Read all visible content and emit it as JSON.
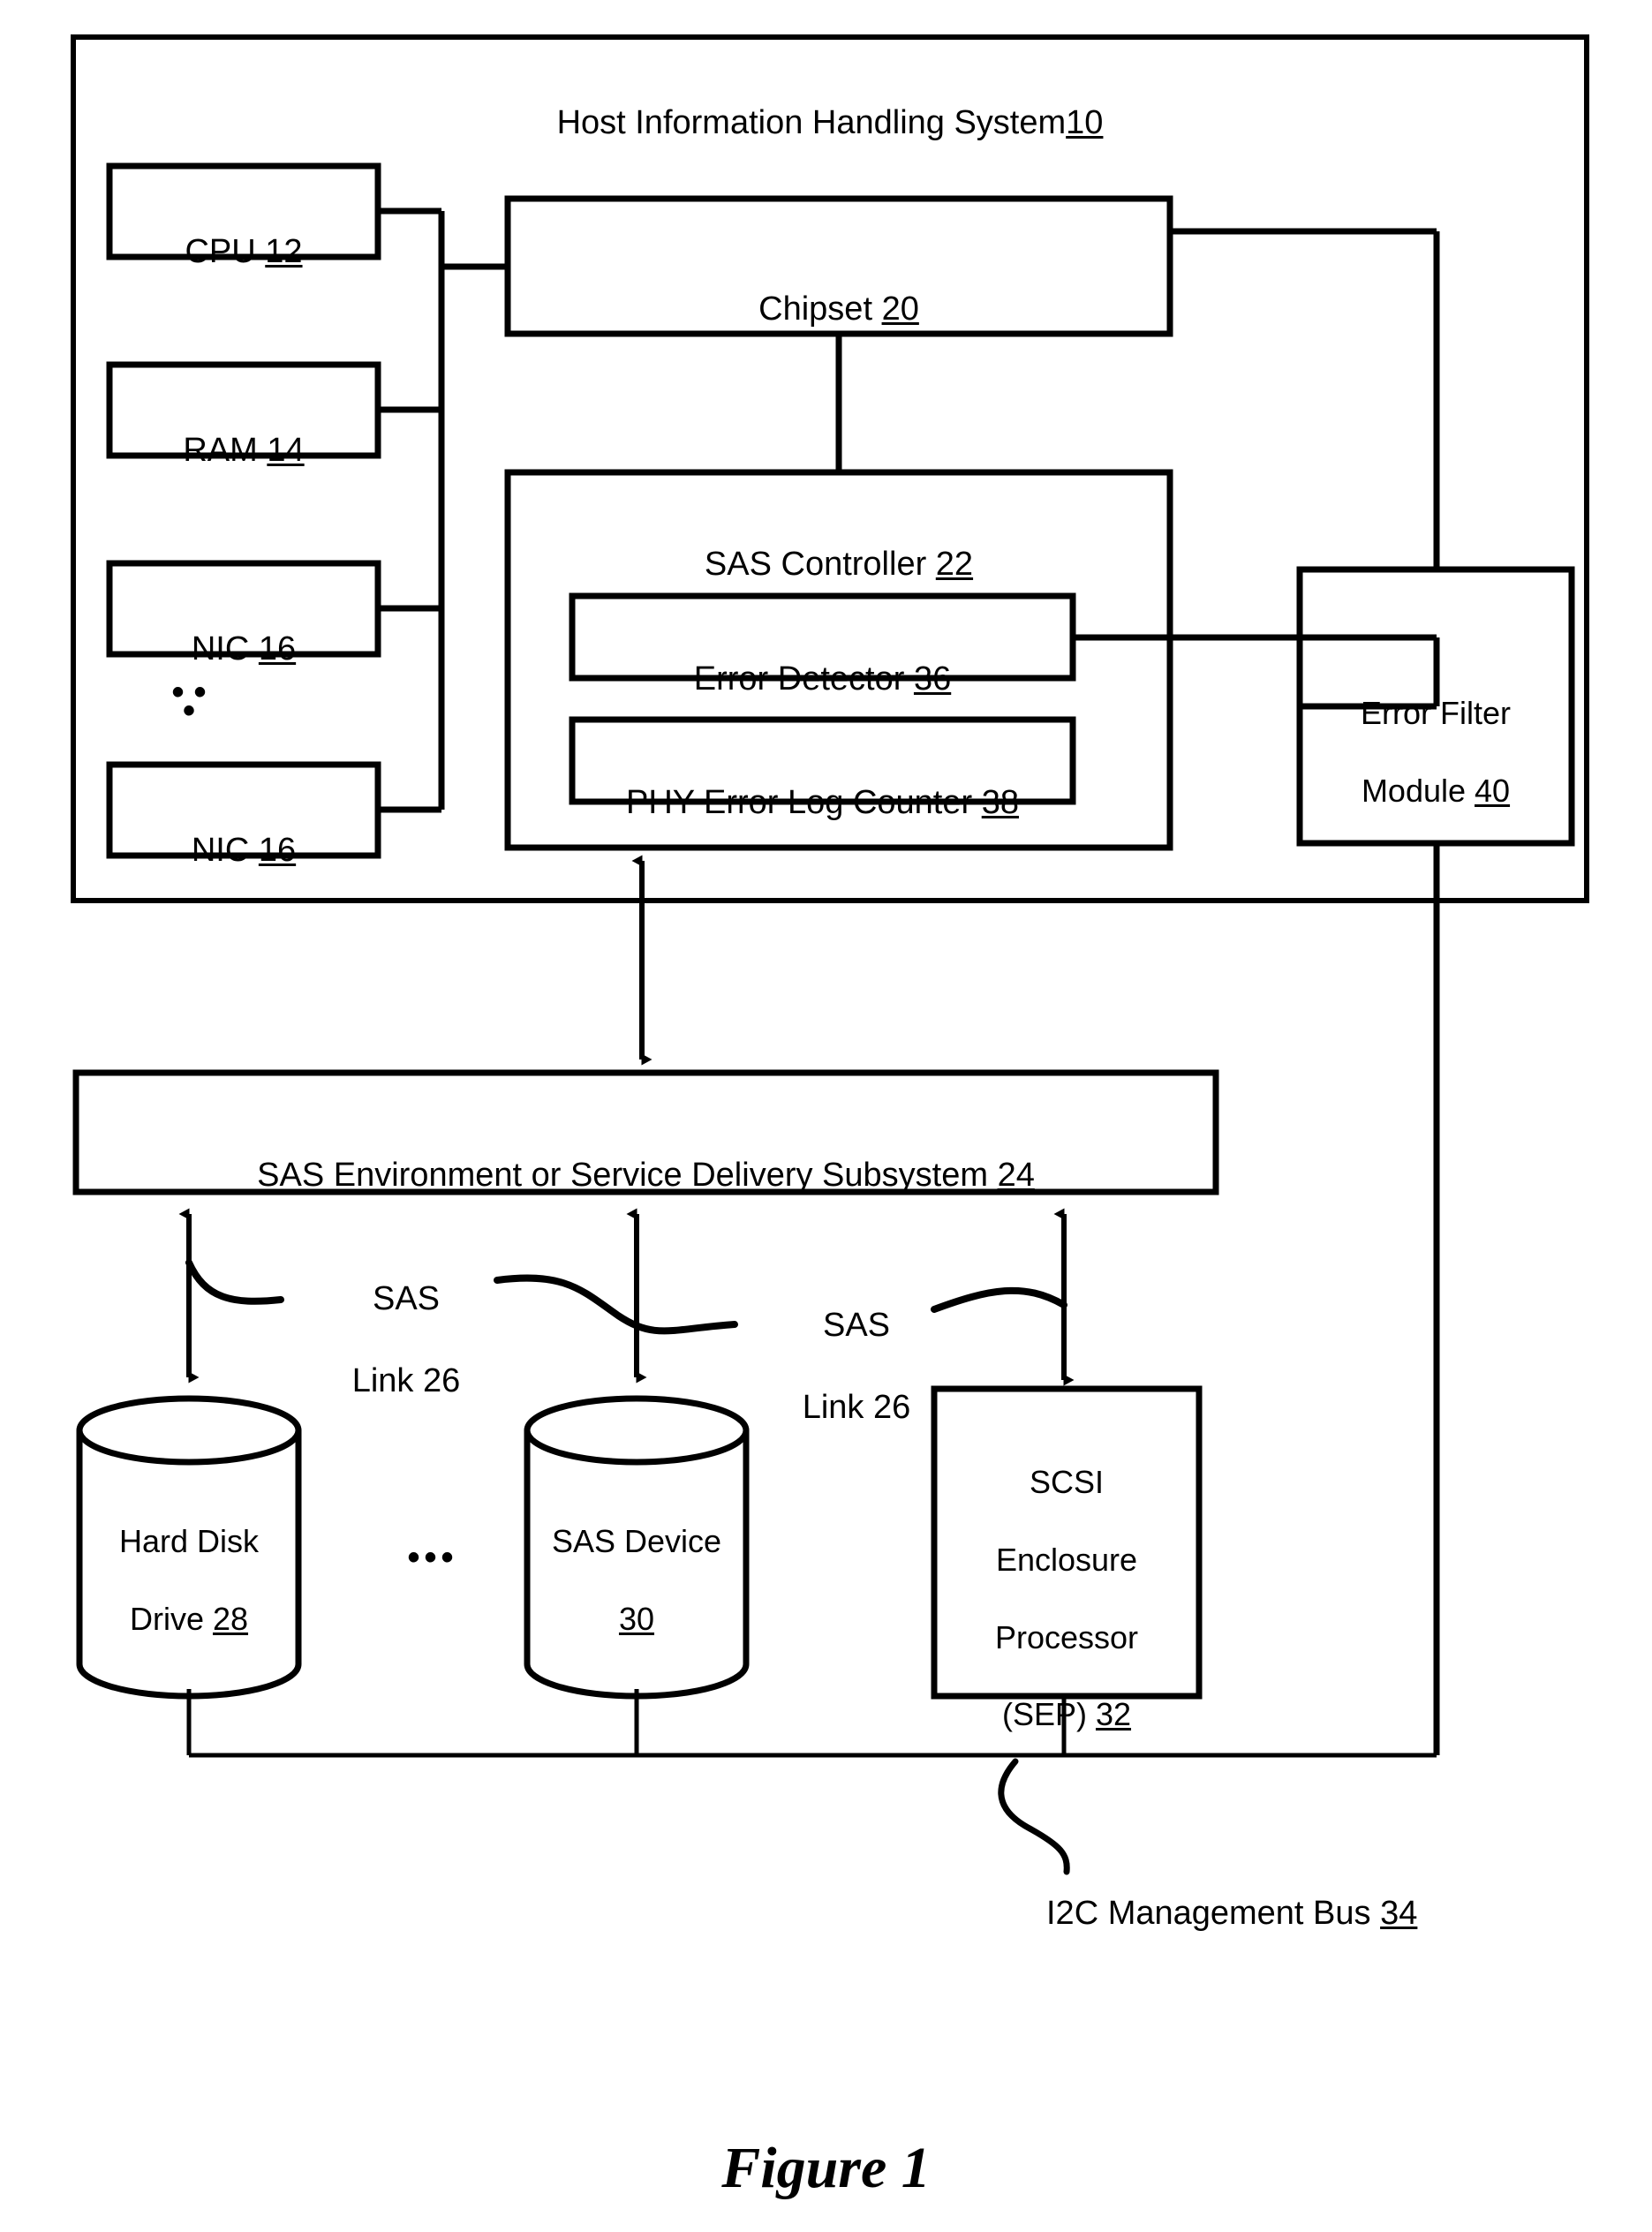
{
  "figure": {
    "caption": "Figure 1"
  },
  "host": {
    "title_text": "Host Information Handling System",
    "title_ref": "10"
  },
  "components": {
    "cpu": {
      "text": "CPU ",
      "ref": "12"
    },
    "ram": {
      "text": "RAM ",
      "ref": "14"
    },
    "nic1": {
      "text": "NIC ",
      "ref": "16"
    },
    "nic2": {
      "text": "NIC ",
      "ref": "16"
    },
    "vertical_ellipsis": "•\n•\n•",
    "chipset": {
      "text": "Chipset ",
      "ref": "20"
    },
    "sas_controller": {
      "text": "SAS Controller ",
      "ref": "22"
    },
    "error_detector": {
      "text": "Error Detector ",
      "ref": "36"
    },
    "phy_error_log_counter": {
      "text": "PHY Error Log Counter ",
      "ref": "38"
    },
    "error_filter_module": {
      "line1": "Error Filter",
      "line2": "Module ",
      "ref": "40"
    }
  },
  "subsystem": {
    "text": "SAS Environment or Service Delivery Subsystem ",
    "ref": "24"
  },
  "links": {
    "sas_link_left": {
      "line1": "SAS",
      "line2": "Link 26"
    },
    "sas_link_right": {
      "line1": "SAS",
      "line2": "Link 26"
    }
  },
  "devices": {
    "hdd": {
      "line1": "Hard Disk",
      "line2": "Drive ",
      "ref": "28"
    },
    "horizontal_ellipsis": "•••",
    "sas_device": {
      "line1": "SAS Device",
      "line2": "",
      "ref": "30"
    },
    "sep": {
      "line1": "SCSI",
      "line2": "Enclosure",
      "line3": "Processor",
      "line4": "(SEP) ",
      "ref": "32"
    }
  },
  "bus": {
    "i2c": {
      "text": "I2C Management Bus ",
      "ref": "34"
    }
  },
  "style": {
    "stroke": "#000000",
    "background": "#ffffff"
  }
}
